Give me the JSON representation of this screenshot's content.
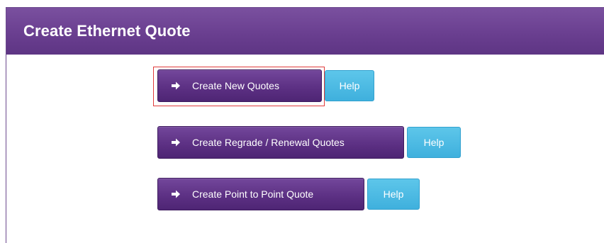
{
  "panel": {
    "title": "Create Ethernet Quote"
  },
  "actions": [
    {
      "label": "Create New Quotes",
      "help_label": "Help",
      "highlighted": true
    },
    {
      "label": "Create Regrade / Renewal Quotes",
      "help_label": "Help",
      "highlighted": false
    },
    {
      "label": "Create Point to Point Quote",
      "help_label": "Help",
      "highlighted": false
    }
  ],
  "colors": {
    "header_purple": "#6a3f90",
    "button_purple": "#5b2f82",
    "help_blue": "#3fb0dd",
    "highlight_red": "#e03b3b"
  },
  "icons": {
    "action_icon": "arrow-right-icon"
  }
}
